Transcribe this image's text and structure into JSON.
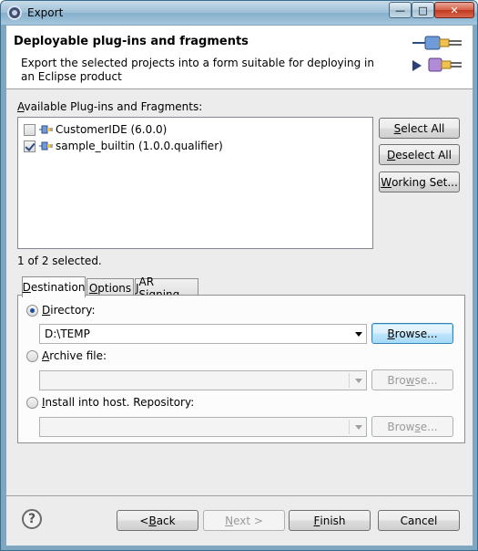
{
  "window": {
    "title": "Export",
    "controls": {
      "minimize": "—",
      "maximize": "□",
      "close": "✕"
    }
  },
  "banner": {
    "title": "Deployable plug-ins and fragments",
    "description": "Export the selected projects into a form suitable for deploying in an Eclipse product",
    "graphic_icon": "plugin-export-icon"
  },
  "available": {
    "label_prefix": "",
    "label_mnemonic": "A",
    "label_rest": "vailable Plug-ins and Fragments:",
    "items": [
      {
        "label": "CustomerIDE (6.0.0)",
        "checked": false,
        "icon": "plugin-icon"
      },
      {
        "label": "sample_builtin (1.0.0.qualifier)",
        "checked": true,
        "icon": "plugin-icon"
      }
    ],
    "selection_status": "1 of 2 selected.",
    "buttons": {
      "select_all": {
        "pre": "",
        "mn": "S",
        "post": "elect All"
      },
      "deselect_all": {
        "pre": "",
        "mn": "D",
        "post": "eselect All"
      },
      "working_set": {
        "pre": "",
        "mn": "W",
        "post": "orking Set..."
      }
    }
  },
  "tabs": [
    {
      "pre": "",
      "mn": "D",
      "post": "estination",
      "active": true
    },
    {
      "pre": "",
      "mn": "O",
      "post": "ptions",
      "active": false
    },
    {
      "pre": "",
      "mn": "J",
      "post": "AR Signing",
      "active": false
    }
  ],
  "destination": {
    "directory": {
      "pre": "",
      "mn": "D",
      "post": "irectory:",
      "selected": true,
      "value": "D:\\TEMP",
      "browse": {
        "pre": "",
        "mn": "B",
        "post": "rowse..."
      }
    },
    "archive": {
      "pre": "",
      "mn": "A",
      "post": "rchive file:",
      "selected": false,
      "value": "",
      "browse": {
        "pre": "Bro",
        "mn": "w",
        "post": "se..."
      }
    },
    "install": {
      "pre": "",
      "mn": "I",
      "post": "nstall into host. Repository:",
      "selected": false,
      "value": "",
      "browse": {
        "pre": "Brow",
        "mn": "s",
        "post": "e..."
      }
    }
  },
  "footer": {
    "help_icon": "help-icon",
    "help_glyph": "?",
    "back": {
      "pre": "< ",
      "mn": "B",
      "post": "ack"
    },
    "next": {
      "pre": "",
      "mn": "N",
      "post": "ext >"
    },
    "finish": {
      "pre": "",
      "mn": "F",
      "post": "inish"
    },
    "cancel": "Cancel"
  }
}
